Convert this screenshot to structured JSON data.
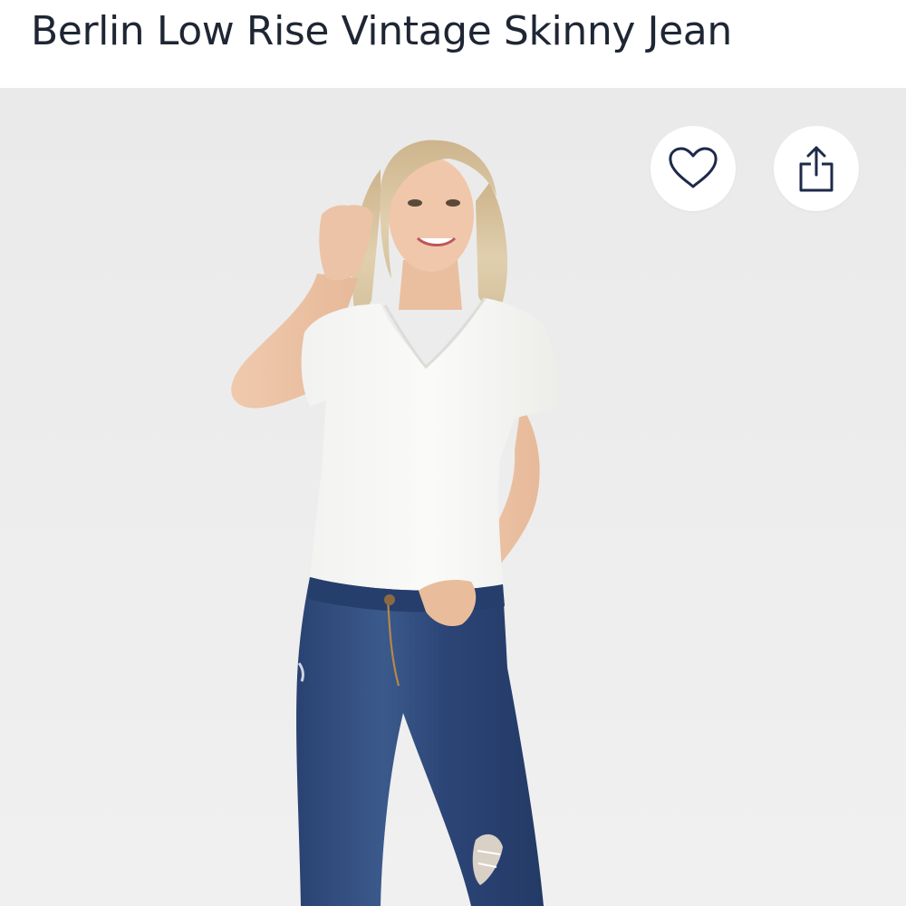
{
  "product": {
    "title": "Berlin Low Rise Vintage Skinny Jean"
  },
  "gallery": {
    "image_alt": "Model wearing white v-neck tee and dark wash distressed skinny jeans",
    "actions": {
      "watch_icon": "heart-icon",
      "share_icon": "share-icon"
    }
  },
  "colors": {
    "title_text": "#1f2633",
    "icon_stroke": "#1e2a4a",
    "gallery_background": "#eeeeee",
    "denim": "#2f4a78",
    "tee": "#f6f6f4"
  }
}
